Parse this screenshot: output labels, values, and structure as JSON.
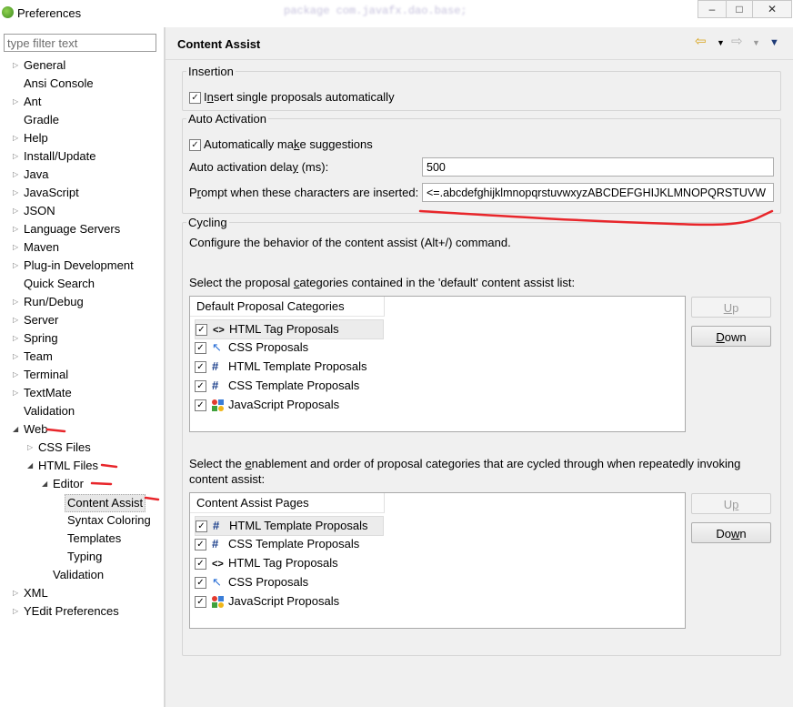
{
  "window": {
    "title": "Preferences",
    "background_text": "package com.javafx.dao.base;",
    "controls": [
      "–",
      "□",
      "✕"
    ]
  },
  "filter": {
    "placeholder": "type filter text"
  },
  "tree": [
    {
      "label": "General",
      "level": 0,
      "expander": "closed"
    },
    {
      "label": "Ansi Console",
      "level": 0,
      "expander": "none"
    },
    {
      "label": "Ant",
      "level": 0,
      "expander": "closed"
    },
    {
      "label": "Gradle",
      "level": 0,
      "expander": "none"
    },
    {
      "label": "Help",
      "level": 0,
      "expander": "closed"
    },
    {
      "label": "Install/Update",
      "level": 0,
      "expander": "closed"
    },
    {
      "label": "Java",
      "level": 0,
      "expander": "closed"
    },
    {
      "label": "JavaScript",
      "level": 0,
      "expander": "closed"
    },
    {
      "label": "JSON",
      "level": 0,
      "expander": "closed"
    },
    {
      "label": "Language Servers",
      "level": 0,
      "expander": "closed"
    },
    {
      "label": "Maven",
      "level": 0,
      "expander": "closed"
    },
    {
      "label": "Plug-in Development",
      "level": 0,
      "expander": "closed"
    },
    {
      "label": "Quick Search",
      "level": 0,
      "expander": "none"
    },
    {
      "label": "Run/Debug",
      "level": 0,
      "expander": "closed"
    },
    {
      "label": "Server",
      "level": 0,
      "expander": "closed"
    },
    {
      "label": "Spring",
      "level": 0,
      "expander": "closed"
    },
    {
      "label": "Team",
      "level": 0,
      "expander": "closed"
    },
    {
      "label": "Terminal",
      "level": 0,
      "expander": "closed"
    },
    {
      "label": "TextMate",
      "level": 0,
      "expander": "closed"
    },
    {
      "label": "Validation",
      "level": 0,
      "expander": "none"
    },
    {
      "label": "Web",
      "level": 0,
      "expander": "open"
    },
    {
      "label": "CSS Files",
      "level": 1,
      "expander": "closed"
    },
    {
      "label": "HTML Files",
      "level": 1,
      "expander": "open"
    },
    {
      "label": "Editor",
      "level": 2,
      "expander": "open"
    },
    {
      "label": "Content Assist",
      "level": 3,
      "expander": "none",
      "selected": true
    },
    {
      "label": "Syntax Coloring",
      "level": 3,
      "expander": "none"
    },
    {
      "label": "Templates",
      "level": 3,
      "expander": "none"
    },
    {
      "label": "Typing",
      "level": 3,
      "expander": "none"
    },
    {
      "label": "Validation",
      "level": 2,
      "expander": "none"
    },
    {
      "label": "XML",
      "level": 0,
      "expander": "closed"
    },
    {
      "label": "YEdit Preferences",
      "level": 0,
      "expander": "closed"
    }
  ],
  "page": {
    "title": "Content Assist",
    "nav_icons": [
      "back-arrow-icon",
      "dropdown-icon",
      "forward-arrow-icon",
      "dropdown-icon",
      "view-menu-icon"
    ]
  },
  "insertion": {
    "legend": "Insertion",
    "insert_single": {
      "label": "Insert single proposals automatically",
      "checked": true
    }
  },
  "auto_activation": {
    "legend": "Auto Activation",
    "make_suggestions": {
      "label": "Automatically make suggestions",
      "checked": true
    },
    "delay_label": "Auto activation delay (ms):",
    "delay_value": "500",
    "prompt_label": "Prompt when these characters are inserted:",
    "prompt_value": "<=.abcdefghijklmnopqrstuvwxyzABCDEFGHIJKLMNOPQRSTUVW"
  },
  "cycling": {
    "legend": "Cycling",
    "description": "Configure the behavior of the content assist (Alt+/) command.",
    "default_list_label": "Select the proposal categories contained in the 'default' content assist list:",
    "default_list_header": "Default Proposal Categories",
    "default_items": [
      {
        "label": "HTML Tag Proposals",
        "icon": "html-tag-icon",
        "checked": true
      },
      {
        "label": "CSS Proposals",
        "icon": "css-cursor-icon",
        "checked": true
      },
      {
        "label": "HTML Template Proposals",
        "icon": "hash-icon",
        "checked": true
      },
      {
        "label": "CSS Template Proposals",
        "icon": "hash-icon",
        "checked": true
      },
      {
        "label": "JavaScript Proposals",
        "icon": "javascript-shapes-icon",
        "checked": true
      }
    ],
    "up_label": "Up",
    "down_label": "Down",
    "cycle_list_label_line1": "Select the enablement and order of proposal categories that are cycled through when repeatedly invoking",
    "cycle_list_label_line2": "content assist:",
    "pages_header": "Content Assist Pages",
    "pages_items": [
      {
        "label": "HTML Template Proposals",
        "icon": "hash-icon",
        "checked": true
      },
      {
        "label": "CSS Template Proposals",
        "icon": "hash-icon",
        "checked": true
      },
      {
        "label": "HTML Tag Proposals",
        "icon": "html-tag-icon",
        "checked": true
      },
      {
        "label": "CSS Proposals",
        "icon": "css-cursor-icon",
        "checked": true
      },
      {
        "label": "JavaScript Proposals",
        "icon": "javascript-shapes-icon",
        "checked": true
      }
    ]
  },
  "colors": {
    "annotation_red": "#e8262b",
    "panel_bg": "#f0f0f0",
    "nav_arrow": "#d9a520"
  }
}
